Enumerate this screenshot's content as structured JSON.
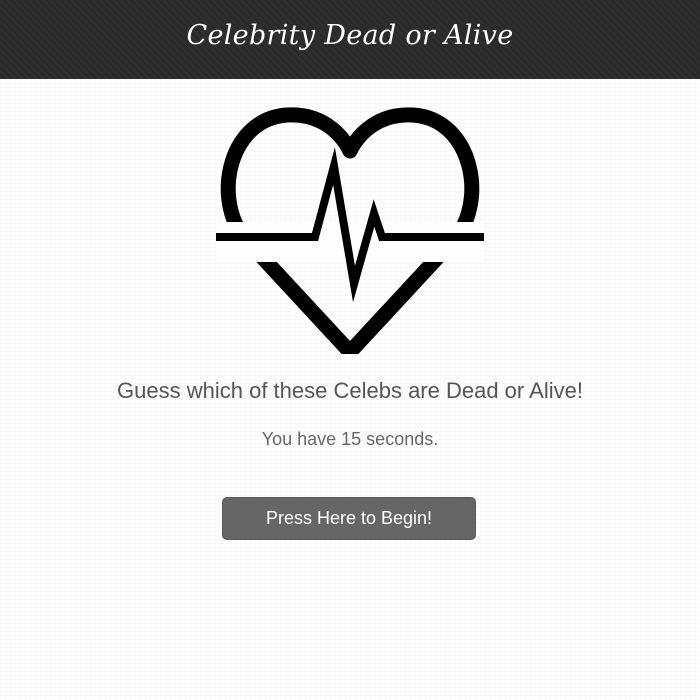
{
  "header": {
    "title": "Celebrity Dead or Alive"
  },
  "hero": {
    "icon": "heartbeat-heart-icon"
  },
  "main": {
    "headline": "Guess which of these Celebs are Dead or Alive!",
    "timer_text": "You have 15 seconds.",
    "begin_button_label": "Press Here to Begin!"
  },
  "colors": {
    "header_bg": "#2a2a2a",
    "button_bg": "#666666",
    "text": "#555555",
    "icon": "#000000"
  }
}
